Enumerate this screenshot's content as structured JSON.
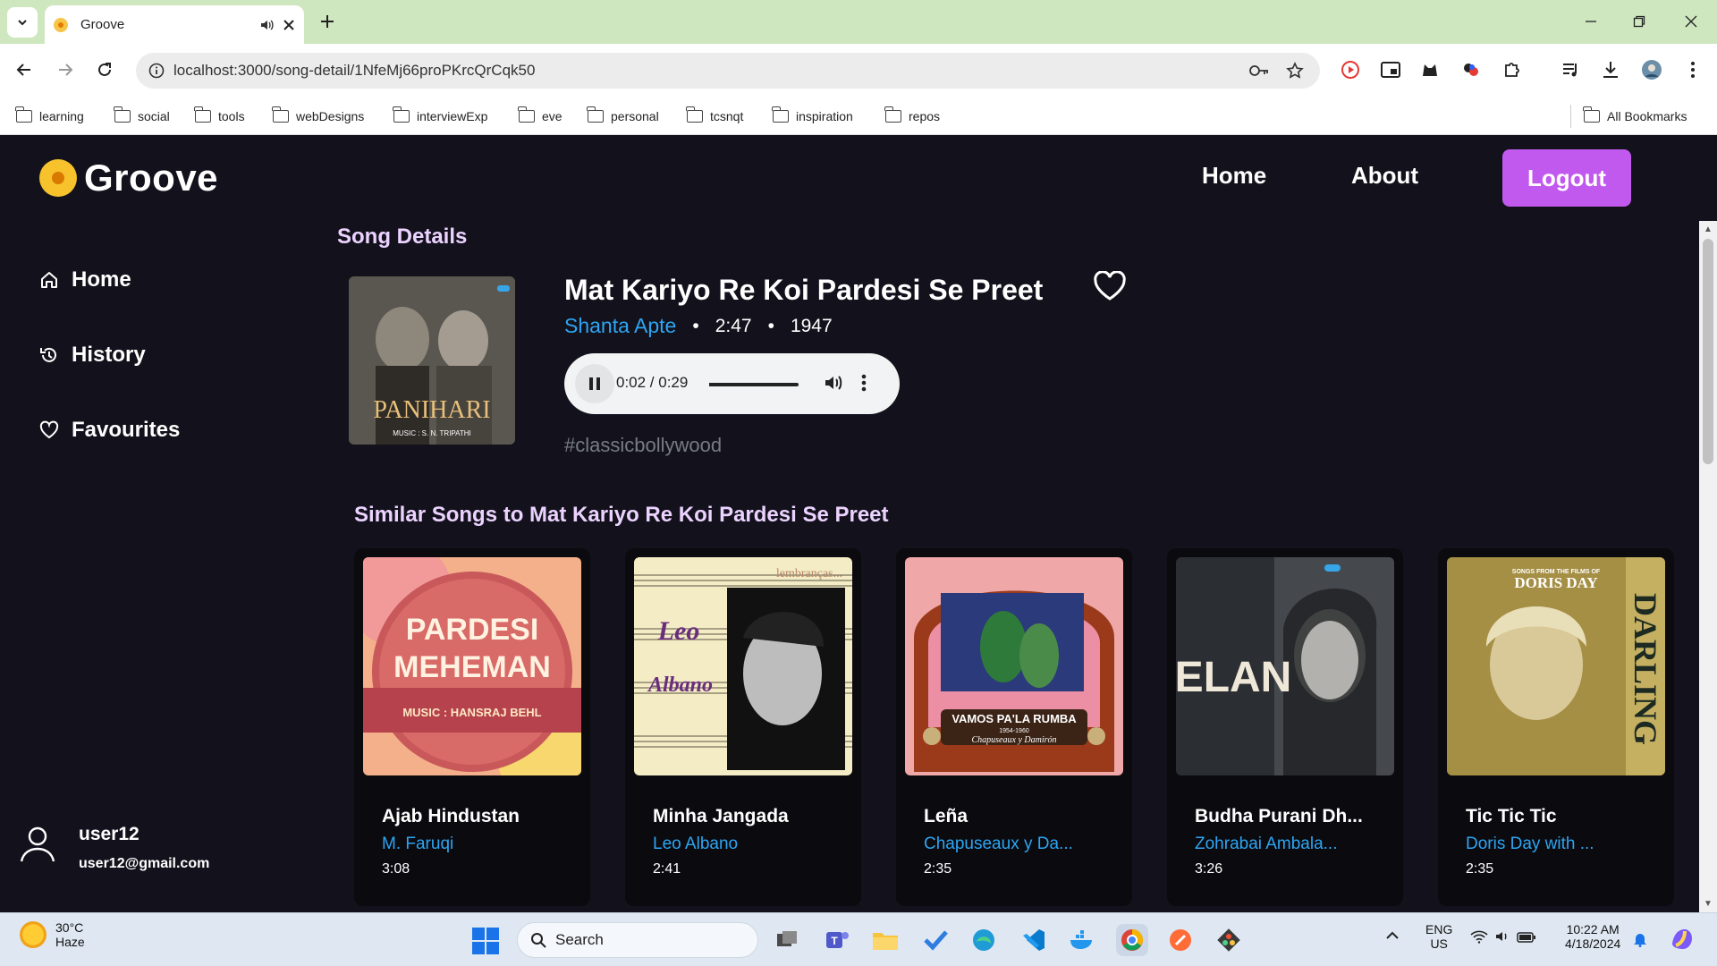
{
  "browser": {
    "tab_title": "Groove",
    "url": "localhost:3000/song-detail/1NfeMj66proPKrcQrCqk50",
    "bookmarks": [
      "learning",
      "social",
      "tools",
      "webDesigns",
      "interviewExp",
      "eve",
      "personal",
      "tcsnqt",
      "inspiration",
      "repos"
    ],
    "all_bookmarks": "All Bookmarks"
  },
  "app": {
    "brand": "Groove",
    "nav": {
      "home": "Home",
      "about": "About",
      "logout": "Logout"
    },
    "sidebar": [
      {
        "label": "Home",
        "icon": "home-icon"
      },
      {
        "label": "History",
        "icon": "history-icon"
      },
      {
        "label": "Favourites",
        "icon": "heart-icon"
      }
    ],
    "user": {
      "name": "user12",
      "email": "user12@gmail.com"
    }
  },
  "song": {
    "section_title": "Song Details",
    "title": "Mat Kariyo Re Koi Pardesi Se Preet",
    "artist": "Shanta Apte",
    "duration": "2:47",
    "year": "1947",
    "player_time": "0:02 / 0:29",
    "player_progress": 0.07,
    "hashtag": "#classicbollywood",
    "cover_text": "PANIHARI",
    "cover_subtext": "MUSIC : S. N. TRIPATHI"
  },
  "similar": {
    "title": "Similar Songs to Mat Kariyo Re Koi Pardesi Se Preet",
    "items": [
      {
        "title": "Ajab Hindustan",
        "artist": "M. Faruqi",
        "duration": "3:08",
        "art_line1": "PARDESI",
        "art_line2": "MEHEMAN",
        "art_line3": "MUSIC : HANSRAJ BEHL"
      },
      {
        "title": "Minha Jangada",
        "artist": "Leo Albano",
        "duration": "2:41",
        "art_line1": "lembranças...",
        "art_line2": "Leo",
        "art_line3": "Albano"
      },
      {
        "title": "Leña",
        "artist": "Chapuseaux y Da...",
        "duration": "2:35",
        "art_line1": "VAMOS PA'LA RUMBA",
        "art_line2": "1954-1960",
        "art_line3": "Chapuseaux y Damirón"
      },
      {
        "title": "Budha Purani Dh...",
        "artist": "Zohrabai Ambala...",
        "duration": "3:26",
        "art_line1": "ELAN",
        "art_line2": "",
        "art_line3": ""
      },
      {
        "title": "Tic Tic Tic",
        "artist": "Doris Day with ...",
        "duration": "2:35",
        "art_line1": "SONGS FROM THE FILMS OF",
        "art_line2": "DORIS DAY",
        "art_line3": "DARLING"
      }
    ]
  },
  "taskbar": {
    "temp": "30°C",
    "weather": "Haze",
    "search": "Search",
    "lang1": "ENG",
    "lang2": "US",
    "time": "10:22 AM",
    "date": "4/18/2024"
  },
  "colors": {
    "accent": "#c259ef",
    "link": "#2da5f2",
    "bg": "#13121c",
    "section": "#ecd3ff"
  }
}
